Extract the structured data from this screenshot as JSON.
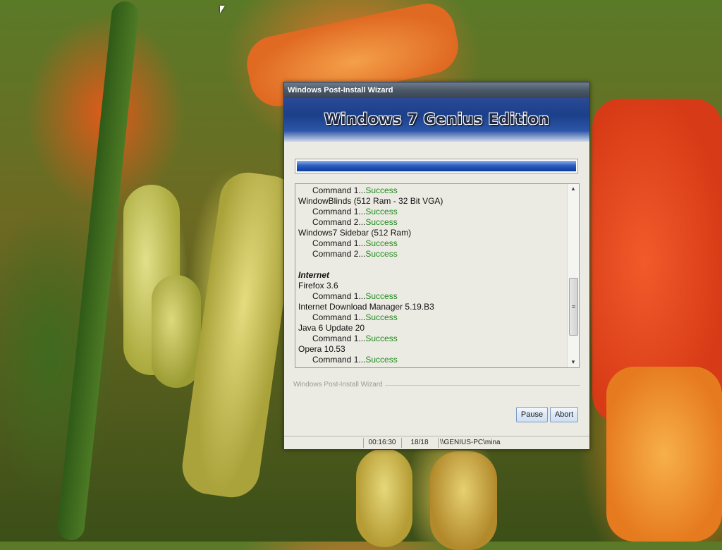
{
  "window": {
    "title": "Windows Post-Install Wizard",
    "banner_title": "Windows 7 Genius Edition",
    "progress_fraction": 1.0
  },
  "log": {
    "lines": [
      {
        "type": "cmd",
        "text": "Command 1...",
        "status": "Success"
      },
      {
        "type": "app",
        "text": "WindowBlinds (512 Ram - 32 Bit VGA)"
      },
      {
        "type": "cmd",
        "text": "Command 1...",
        "status": "Success"
      },
      {
        "type": "cmd",
        "text": "Command 2...",
        "status": "Success"
      },
      {
        "type": "app",
        "text": "Windows7 Sidebar (512 Ram)"
      },
      {
        "type": "cmd",
        "text": "Command 1...",
        "status": "Success"
      },
      {
        "type": "cmd",
        "text": "Command 2...",
        "status": "Success"
      },
      {
        "type": "blank",
        "text": ""
      },
      {
        "type": "cat",
        "text": "Internet"
      },
      {
        "type": "app",
        "text": "Firefox 3.6"
      },
      {
        "type": "cmd",
        "text": "Command 1...",
        "status": "Success"
      },
      {
        "type": "app",
        "text": "Internet Download Manager 5.19.B3"
      },
      {
        "type": "cmd",
        "text": "Command 1...",
        "status": "Success"
      },
      {
        "type": "app",
        "text": "Java 6 Update 20"
      },
      {
        "type": "cmd",
        "text": "Command 1...",
        "status": "Success"
      },
      {
        "type": "app",
        "text": "Opera 10.53"
      },
      {
        "type": "cmd",
        "text": "Command 1...",
        "status": "Success"
      }
    ]
  },
  "groupbox_label": "Windows Post-Install Wizard",
  "buttons": {
    "pause": "Pause",
    "abort": "Abort"
  },
  "statusbar": {
    "elapsed": "00:16:30",
    "count": "18/18",
    "user": "\\\\GENIUS-PC\\mina"
  },
  "colors": {
    "success": "#1f8a1f",
    "accent": "#1c3f8a"
  },
  "icons": {
    "scroll_up": "triangle-up",
    "scroll_down": "triangle-down",
    "scroll_grip": "grip-lines"
  }
}
